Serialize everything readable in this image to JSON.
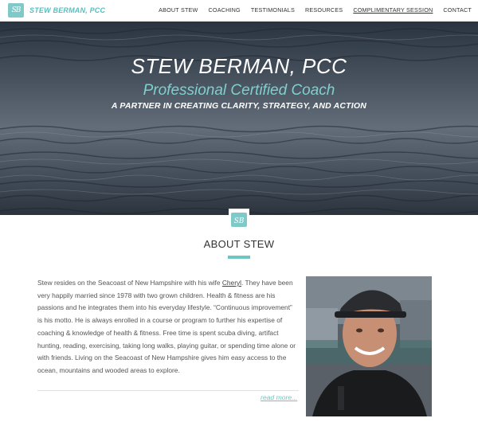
{
  "header": {
    "logo_monogram": "SB",
    "logo_text": "STEW BERMAN, PCC",
    "nav": [
      {
        "label": "ABOUT STEW"
      },
      {
        "label": "COACHING"
      },
      {
        "label": "TESTIMONIALS"
      },
      {
        "label": "RESOURCES"
      },
      {
        "label": "COMPLIMENTARY SESSION",
        "current": true
      },
      {
        "label": "CONTACT"
      }
    ]
  },
  "hero": {
    "title": "STEW BERMAN, PCC",
    "subtitle": "Professional Certified Coach",
    "tagline": "A PARTNER IN CREATING CLARITY, STRATEGY, AND ACTION"
  },
  "about": {
    "badge_monogram": "SB",
    "title": "ABOUT STEW",
    "bio_before": "Stew resides on the Seacoast of New Hampshire with his wife ",
    "bio_wife": "Cheryl",
    "bio_after": ". They have been very happily married since 1978 with two grown children. Health & fitness are his passions and he integrates them into his everyday lifestyle. “Continuous improvement” is his motto. He is always enrolled in a course or program to further his expertise of coaching & knowledge of health & fitness. Free time is spent scuba diving, artifact hunting, reading, exercising, taking long walks, playing guitar, or spending time alone or with friends. Living on the Seacoast of New Hampshire gives him easy access to the ocean, mountains and wooded areas to explore.",
    "read_more": "read more..."
  },
  "colors": {
    "accent": "#6ec6c3",
    "logo": "#5bbdbd",
    "hero_bg": "#3b4653"
  }
}
